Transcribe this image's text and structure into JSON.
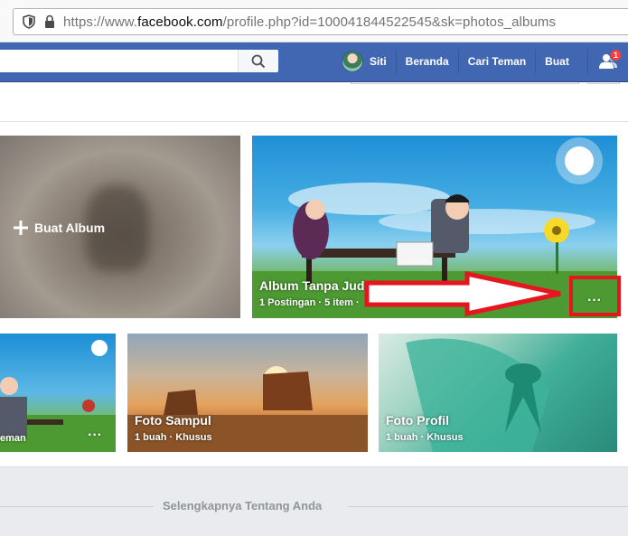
{
  "browser": {
    "url_prefix": "https://www.",
    "url_domain": "facebook.com",
    "url_path": "/profile.php?id=100041844522545&sk=photos_albums"
  },
  "header": {
    "search_placeholder": "",
    "profile_name": "Siti",
    "nav_home": "Beranda",
    "nav_find_friends": "Cari Teman",
    "nav_create": "Buat",
    "friend_requests_count": "1",
    "brand_color": "#4267b2"
  },
  "albums": {
    "create": {
      "label": "Buat Album",
      "icon": "plus-icon"
    },
    "items": [
      {
        "title": "Album Tanpa Judul",
        "subtitle": "1 Postingan · 5 item ·"
      },
      {
        "title": "",
        "subtitle": "eman"
      },
      {
        "title": "Foto Sampul",
        "subtitle": "1 buah · Khusus"
      },
      {
        "title": "Foto Profil",
        "subtitle": "1 buah · Khusus"
      }
    ],
    "options_glyph": "···"
  },
  "footer": {
    "about_link": "Selengkapnya Tentang Anda"
  },
  "annotation": {
    "color": "#e7151d"
  }
}
